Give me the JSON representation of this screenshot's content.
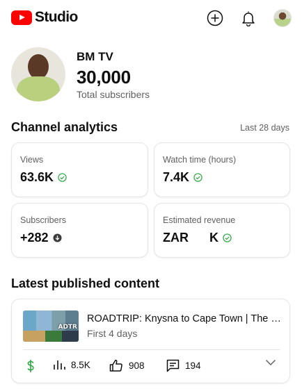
{
  "header": {
    "app_name": "Studio",
    "icons": [
      "create-icon",
      "notifications-icon",
      "account-avatar"
    ]
  },
  "channel": {
    "name": "BM TV",
    "subscribers": "30,000",
    "subscribers_label": "Total subscribers"
  },
  "analytics": {
    "title": "Channel analytics",
    "period": "Last 28 days",
    "cards": [
      {
        "label": "Views",
        "value": "63.6K",
        "status": "check"
      },
      {
        "label": "Watch time (hours)",
        "value": "7.4K",
        "status": "check"
      },
      {
        "label": "Subscribers",
        "value": "+282",
        "status": "down"
      },
      {
        "label": "Estimated revenue",
        "currency": "ZAR",
        "value": "K",
        "status": "check"
      }
    ]
  },
  "latest": {
    "title": "Latest published content",
    "video": {
      "title": "ROADTRIP: Knysna to Cape Town | The Garden Route",
      "meta": "First 4 days",
      "thumbnail_text": "ADTR",
      "views": "8.5K",
      "likes": "908",
      "comments": "194"
    }
  },
  "colors": {
    "brand_red": "#ff0000",
    "text": "#0f0f0f",
    "secondary": "#606060",
    "success": "#2ba640"
  }
}
